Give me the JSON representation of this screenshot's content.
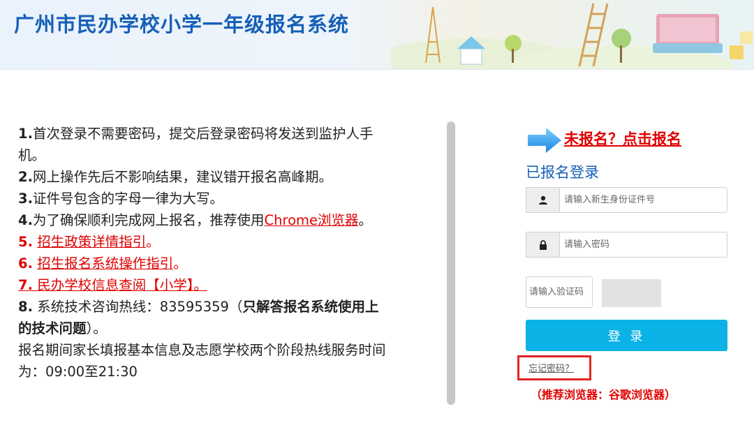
{
  "header": {
    "title": "广州市民办学校小学一年级报名系统"
  },
  "notes": [
    {
      "num": "1.",
      "text": "首次登录不需要密码，提交后登录密码将发送到监护人手机。"
    },
    {
      "num": "2.",
      "text": "网上操作先后不影响结果，建议错开报名高峰期。"
    },
    {
      "num": "3.",
      "text": "证件号包含的字母一律为大写。"
    },
    {
      "num": "4.",
      "text_before": "为了确保顺利完成网上报名，推荐使用",
      "link": "Chrome浏览器",
      "text_after": "。"
    },
    {
      "num": "5.",
      "link": "招生政策详情指引",
      "text_after": "。"
    },
    {
      "num": "6.",
      "link": "招生报名系统操作指引",
      "text_after": "。"
    },
    {
      "num": "7.",
      "link": "民办学校信息查阅【小学】。"
    },
    {
      "num": "8.",
      "text_before": "系统技术咨询热线：83595359（",
      "bold": "只解答报名系统使用上的技术问题",
      "text_after": "）。"
    },
    {
      "text": "报名期间家长填报基本信息及志愿学校两个阶段热线服务时间为：09:00至21:30"
    }
  ],
  "login": {
    "register_link": "未报名？点击报名",
    "title": "已报名登录",
    "id_placeholder": "请输入新生身份证件号",
    "password_placeholder": "请输入密码",
    "captcha_placeholder": "请输入验证码",
    "login_button": "登 录",
    "forgot_password": "忘记密码？",
    "browser_tip": "（推荐浏览器：谷歌浏览器）"
  },
  "colors": {
    "title_blue": "#1660b8",
    "link_red": "#e00000",
    "button_blue": "#0bb2e6",
    "highlight_red": "#e32424"
  },
  "icons": {
    "register_arrow": "arrow-right-icon",
    "id_field": "user-icon",
    "password_field": "lock-icon"
  }
}
